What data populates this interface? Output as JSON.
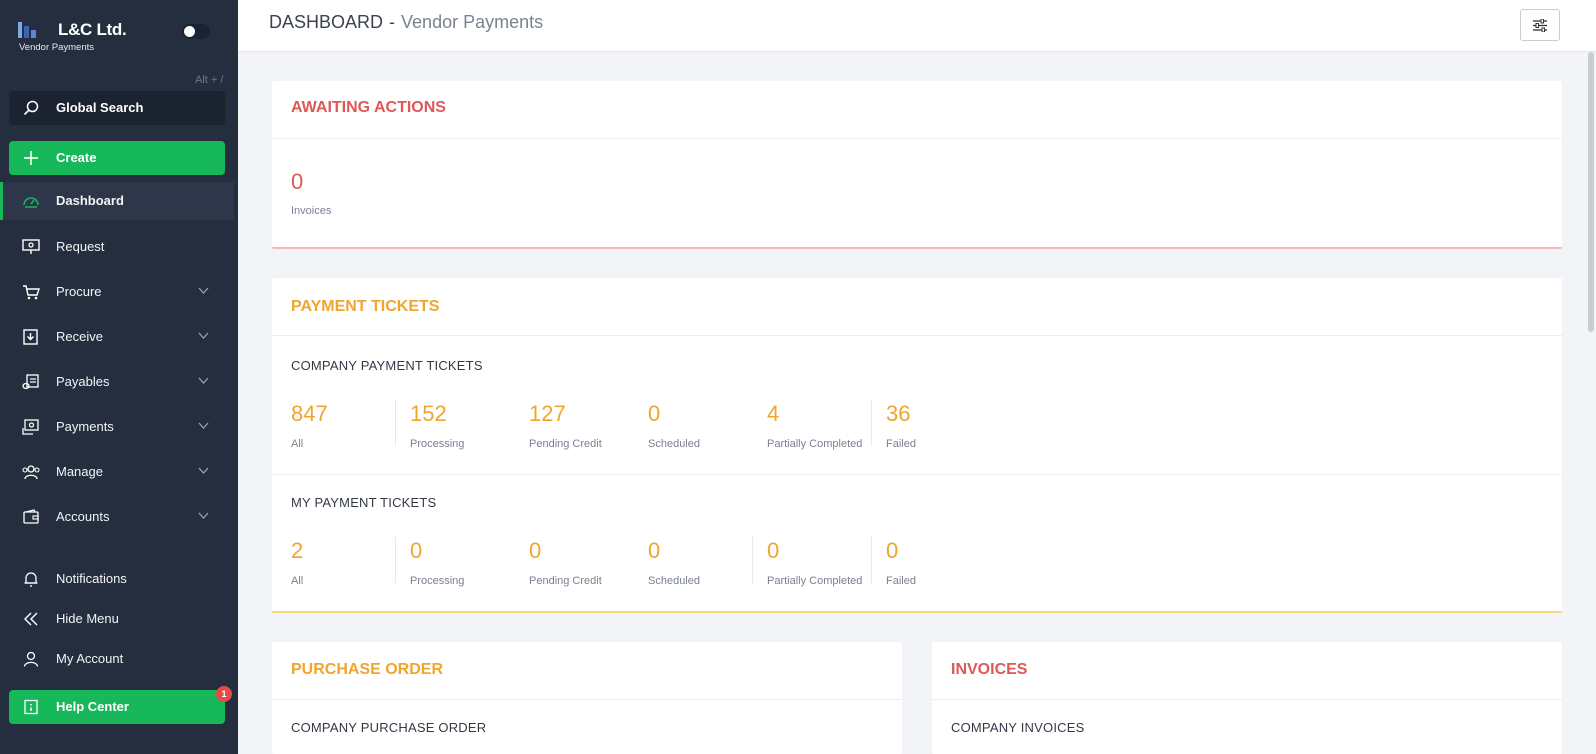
{
  "brand": {
    "name": "L&C Ltd.",
    "subtitle": "Vendor Payments"
  },
  "shortcut_hint": "Alt + /",
  "search": {
    "label": "Global Search"
  },
  "create": {
    "label": "Create"
  },
  "nav": [
    {
      "label": "Dashboard",
      "icon": "dashboard-icon"
    },
    {
      "label": "Request",
      "icon": "request-icon"
    },
    {
      "label": "Procure",
      "icon": "cart-icon"
    },
    {
      "label": "Receive",
      "icon": "receive-icon"
    },
    {
      "label": "Payables",
      "icon": "payables-icon"
    },
    {
      "label": "Payments",
      "icon": "payments-icon"
    },
    {
      "label": "Manage",
      "icon": "users-icon"
    },
    {
      "label": "Accounts",
      "icon": "wallet-icon"
    }
  ],
  "bottom_nav": {
    "notifications": "Notifications",
    "hide_menu": "Hide Menu",
    "my_account": "My Account",
    "help_center": "Help Center",
    "help_badge": "1"
  },
  "header": {
    "title": "DASHBOARD",
    "separator": "-",
    "subtitle": "Vendor Payments"
  },
  "colors": {
    "sidebar": "#252e3e",
    "accent_green": "#16b85a",
    "red": "#e05757",
    "orange": "#f0a52d"
  },
  "awaiting": {
    "title": "AWAITING ACTIONS",
    "count": "0",
    "label": "Invoices"
  },
  "payment_tickets": {
    "title": "PAYMENT TICKETS",
    "company": {
      "title": "COMPANY PAYMENT TICKETS",
      "stats": [
        {
          "value": "847",
          "label": "All"
        },
        {
          "value": "152",
          "label": "Processing"
        },
        {
          "value": "127",
          "label": "Pending Credit"
        },
        {
          "value": "0",
          "label": "Scheduled"
        },
        {
          "value": "4",
          "label": "Partially Completed"
        },
        {
          "value": "36",
          "label": "Failed"
        }
      ]
    },
    "mine": {
      "title": "MY PAYMENT TICKETS",
      "stats": [
        {
          "value": "2",
          "label": "All"
        },
        {
          "value": "0",
          "label": "Processing"
        },
        {
          "value": "0",
          "label": "Pending Credit"
        },
        {
          "value": "0",
          "label": "Scheduled"
        },
        {
          "value": "0",
          "label": "Partially Completed"
        },
        {
          "value": "0",
          "label": "Failed"
        }
      ]
    }
  },
  "purchase_order": {
    "title": "PURCHASE ORDER",
    "section": "COMPANY PURCHASE ORDER"
  },
  "invoices": {
    "title": "INVOICES",
    "section": "COMPANY INVOICES"
  }
}
